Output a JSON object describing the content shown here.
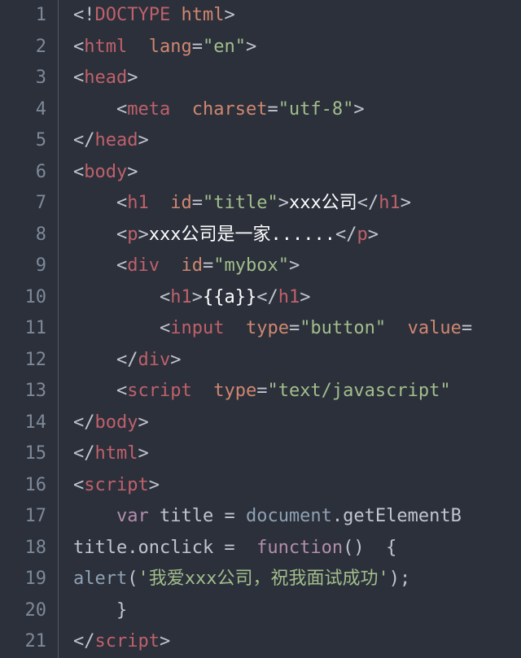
{
  "editor": {
    "lineCount": 21,
    "lines": {
      "1": [
        [
          "c-punc",
          "<!"
        ],
        [
          "c-tag",
          "DOCTYPE"
        ],
        [
          "c-text",
          " "
        ],
        [
          "c-attr",
          "html"
        ],
        [
          "c-punc",
          ">"
        ]
      ],
      "2": [
        [
          "c-punc",
          "<"
        ],
        [
          "c-tag",
          "html"
        ],
        [
          "c-text",
          "  "
        ],
        [
          "c-attr",
          "lang"
        ],
        [
          "c-punc",
          "="
        ],
        [
          "c-string",
          "\"en\""
        ],
        [
          "c-punc",
          ">"
        ]
      ],
      "3": [
        [
          "c-punc",
          "<"
        ],
        [
          "c-tag",
          "head"
        ],
        [
          "c-punc",
          ">"
        ]
      ],
      "4": [
        [
          "c-text",
          "    "
        ],
        [
          "c-punc",
          "<"
        ],
        [
          "c-tag",
          "meta"
        ],
        [
          "c-text",
          "  "
        ],
        [
          "c-attr",
          "charset"
        ],
        [
          "c-punc",
          "="
        ],
        [
          "c-string",
          "\"utf-8\""
        ],
        [
          "c-punc",
          ">"
        ]
      ],
      "5": [
        [
          "c-punc",
          "</"
        ],
        [
          "c-tag",
          "head"
        ],
        [
          "c-punc",
          ">"
        ]
      ],
      "6": [
        [
          "c-punc",
          "<"
        ],
        [
          "c-tag",
          "body"
        ],
        [
          "c-punc",
          ">"
        ]
      ],
      "7": [
        [
          "c-text",
          "    "
        ],
        [
          "c-punc",
          "<"
        ],
        [
          "c-tag",
          "h1"
        ],
        [
          "c-text",
          "  "
        ],
        [
          "c-attr",
          "id"
        ],
        [
          "c-punc",
          "="
        ],
        [
          "c-string",
          "\"title\""
        ],
        [
          "c-punc",
          ">"
        ],
        [
          "c-text",
          "xxx公司"
        ],
        [
          "c-punc",
          "</"
        ],
        [
          "c-tag",
          "h1"
        ],
        [
          "c-punc",
          ">"
        ]
      ],
      "8": [
        [
          "c-text",
          "    "
        ],
        [
          "c-punc",
          "<"
        ],
        [
          "c-tag",
          "p"
        ],
        [
          "c-punc",
          ">"
        ],
        [
          "c-text",
          "xxx公司是一家......"
        ],
        [
          "c-punc",
          "</"
        ],
        [
          "c-tag",
          "p"
        ],
        [
          "c-punc",
          ">"
        ]
      ],
      "9": [
        [
          "c-text",
          "    "
        ],
        [
          "c-punc",
          "<"
        ],
        [
          "c-tag",
          "div"
        ],
        [
          "c-text",
          "  "
        ],
        [
          "c-attr",
          "id"
        ],
        [
          "c-punc",
          "="
        ],
        [
          "c-string",
          "\"mybox\""
        ],
        [
          "c-punc",
          ">"
        ]
      ],
      "10": [
        [
          "c-text",
          "        "
        ],
        [
          "c-punc",
          "<"
        ],
        [
          "c-tag",
          "h1"
        ],
        [
          "c-punc",
          ">"
        ],
        [
          "c-text",
          "{{a}}"
        ],
        [
          "c-punc",
          "</"
        ],
        [
          "c-tag",
          "h1"
        ],
        [
          "c-punc",
          ">"
        ]
      ],
      "11": [
        [
          "c-text",
          "        "
        ],
        [
          "c-punc",
          "<"
        ],
        [
          "c-tag",
          "input"
        ],
        [
          "c-text",
          "  "
        ],
        [
          "c-attr",
          "type"
        ],
        [
          "c-punc",
          "="
        ],
        [
          "c-string",
          "\"button\""
        ],
        [
          "c-text",
          "  "
        ],
        [
          "c-attr",
          "value"
        ],
        [
          "c-punc",
          "="
        ]
      ],
      "12": [
        [
          "c-text",
          "    "
        ],
        [
          "c-punc",
          "</"
        ],
        [
          "c-tag",
          "div"
        ],
        [
          "c-punc",
          ">"
        ]
      ],
      "13": [
        [
          "c-text",
          "    "
        ],
        [
          "c-punc",
          "<"
        ],
        [
          "c-tag",
          "script"
        ],
        [
          "c-text",
          "  "
        ],
        [
          "c-attr",
          "type"
        ],
        [
          "c-punc",
          "="
        ],
        [
          "c-string",
          "\"text/javascript\""
        ]
      ],
      "14": [
        [
          "c-punc",
          "</"
        ],
        [
          "c-tag",
          "body"
        ],
        [
          "c-punc",
          ">"
        ]
      ],
      "15": [
        [
          "c-punc",
          "</"
        ],
        [
          "c-tag",
          "html"
        ],
        [
          "c-punc",
          ">"
        ]
      ],
      "16": [
        [
          "c-punc",
          "<"
        ],
        [
          "c-tag",
          "script"
        ],
        [
          "c-punc",
          ">"
        ]
      ],
      "17": [
        [
          "c-text",
          "    "
        ],
        [
          "c-keyword",
          "var"
        ],
        [
          "c-text",
          " "
        ],
        [
          "c-ident",
          "title = "
        ],
        [
          "c-func",
          "document"
        ],
        [
          "c-ident",
          ".getElementB"
        ]
      ],
      "18": [
        [
          "c-ident",
          "title.onclick =  "
        ],
        [
          "c-keyword",
          "function"
        ],
        [
          "c-ident",
          "()  {"
        ]
      ],
      "19": [
        [
          "c-func",
          "alert"
        ],
        [
          "c-ident",
          "("
        ],
        [
          "c-string",
          "'我爱xxx公司，祝我面试成功'"
        ],
        [
          "c-ident",
          ");"
        ]
      ],
      "20": [
        [
          "c-ident",
          "    }"
        ]
      ],
      "21": [
        [
          "c-punc",
          "</"
        ],
        [
          "c-tag",
          "script"
        ],
        [
          "c-punc",
          ">"
        ]
      ]
    }
  }
}
